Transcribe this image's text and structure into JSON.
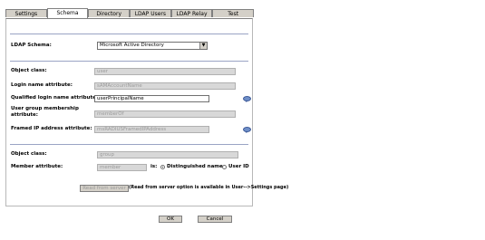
{
  "tabs": [
    {
      "label": "Settings",
      "active": false
    },
    {
      "label": "Schema",
      "active": true
    },
    {
      "label": "Directory",
      "active": false
    },
    {
      "label": "LDAP Users",
      "active": false
    },
    {
      "label": "LDAP Relay",
      "active": false
    },
    {
      "label": "Test",
      "active": false
    }
  ],
  "ldap_schema": {
    "label": "LDAP Schema:",
    "value": "Microsoft Active Directory"
  },
  "user_section": {
    "object_class": {
      "label": "Object class:",
      "value": "user"
    },
    "login_name": {
      "label": "Login name attribute:",
      "value": "sAMAccountName"
    },
    "qualified_login": {
      "label": "Qualified login name attribute:",
      "value": "userPrincipalName"
    },
    "group_membership": {
      "label_line1": "User group membership",
      "label_line2": "attribute:",
      "value": "memberOf"
    },
    "framed_ip": {
      "label": "Framed IP address attribute:",
      "value": "msRADIUSFramedIPAddress"
    }
  },
  "group_section": {
    "object_class": {
      "label": "Object class:",
      "value": "group"
    },
    "member_attr": {
      "label": "Member attribute:",
      "value": "member",
      "is_label": "is:"
    },
    "distinguished_name": "Distinguished name",
    "user_id": "User ID",
    "read_button": "Read from server",
    "read_note": "(Read from server option is available in User-->Settings page)"
  },
  "footer": {
    "ok": "OK",
    "cancel": "Cancel"
  }
}
